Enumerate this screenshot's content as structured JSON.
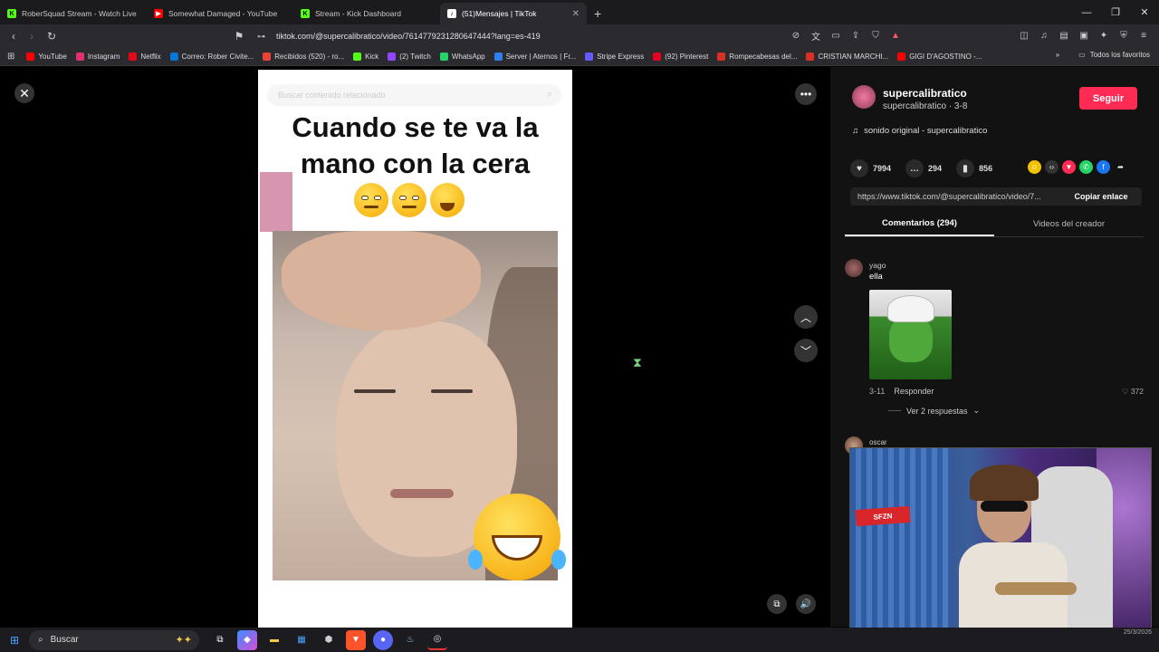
{
  "browser": {
    "tabs": [
      {
        "label": "RoberSquad Stream - Watch Live",
        "fav_color": "#53fc18",
        "fav_glyph": "K"
      },
      {
        "label": "Somewhat Damaged - YouTube",
        "fav_color": "#ff0000",
        "fav_glyph": "▶"
      },
      {
        "label": "Stream - Kick Dashboard",
        "fav_color": "#53fc18",
        "fav_glyph": "K"
      },
      {
        "label": "(51)Mensajes | TikTok",
        "fav_color": "#ffffff",
        "fav_glyph": "♪"
      }
    ],
    "url": "tiktok.com/@supercalibratico/video/7614779231280647444?lang=es-419",
    "bookmarks": [
      {
        "label": "YouTube",
        "color": "#ff0000"
      },
      {
        "label": "Instagram",
        "color": "#e1306c"
      },
      {
        "label": "Netflix",
        "color": "#e50914"
      },
      {
        "label": "Correo: Rober Civite...",
        "color": "#0078d4"
      },
      {
        "label": "Recibidos (520) - ro...",
        "color": "#ea4335"
      },
      {
        "label": "Kick",
        "color": "#53fc18"
      },
      {
        "label": "(2) Twitch",
        "color": "#9146ff"
      },
      {
        "label": "WhatsApp",
        "color": "#25d366"
      },
      {
        "label": "Server | Aternos | Fr...",
        "color": "#2f80ed"
      },
      {
        "label": "Stripe Express",
        "color": "#635bff"
      },
      {
        "label": "(92) Pinterest",
        "color": "#e60023"
      },
      {
        "label": "Rompecabesas del...",
        "color": "#d93025"
      },
      {
        "label": "CRISTIAN MARCHI...",
        "color": "#d93025"
      },
      {
        "label": "GIGI D'AGOSTINO -...",
        "color": "#ff0000"
      }
    ],
    "all_favorites": "Todos los favoritos"
  },
  "video": {
    "search_placeholder": "Buscar contenido relacionado",
    "caption_line1": "Cuando se te va la",
    "caption_line2": "mano con la cera"
  },
  "creator": {
    "name": "supercalibratico",
    "handle": "supercalibratico · 3-8",
    "follow_label": "Seguir",
    "sound": "sonido original - supercalibratico"
  },
  "stats": {
    "likes": "7994",
    "comments": "294",
    "saves": "856"
  },
  "link": {
    "url": "https://www.tiktok.com/@supercalibratico/video/7...",
    "copy_label": "Copiar enlace"
  },
  "tabs": {
    "comments": "Comentarios (294)",
    "creator_videos": "Videos del creador"
  },
  "comments": [
    {
      "user": "yago",
      "text": "ella",
      "date": "3-11",
      "reply": "Responder",
      "likes": "372",
      "more_replies": "Ver 2 respuestas"
    },
    {
      "user": "oscar"
    }
  ],
  "webcam": {
    "sign_text": "SFZN"
  },
  "taskbar": {
    "search_label": "Buscar",
    "tray_date": "25/3/2026"
  }
}
